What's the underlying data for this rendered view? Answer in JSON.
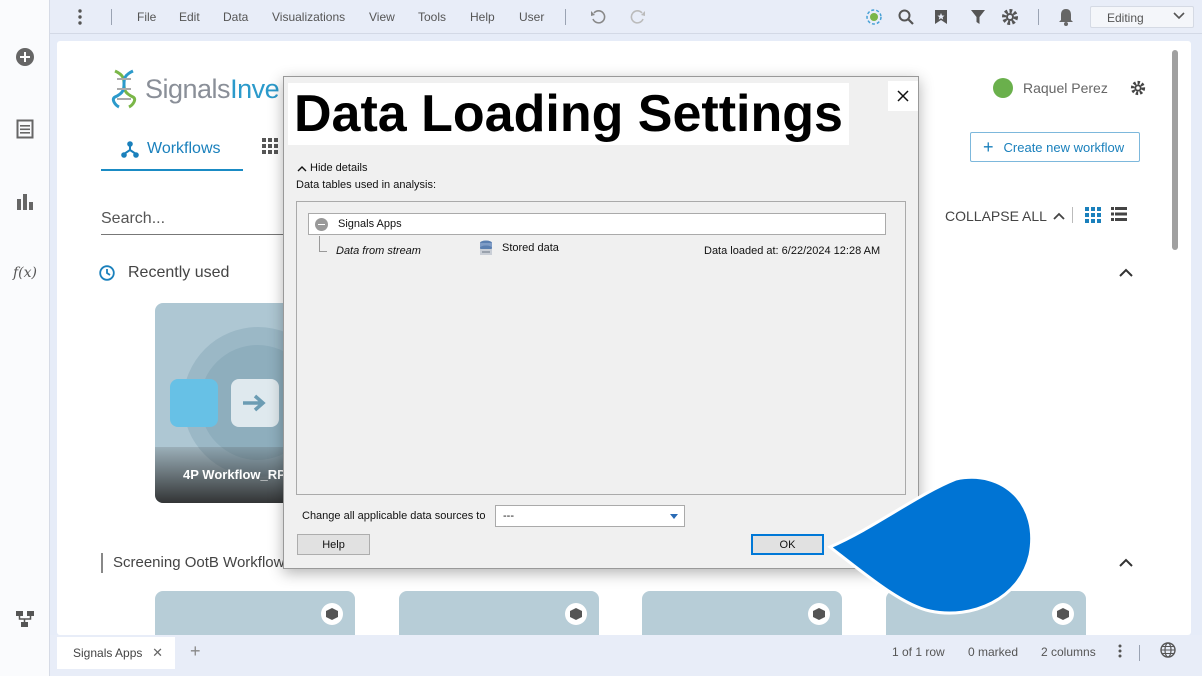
{
  "menubar": {
    "items": [
      "File",
      "Edit",
      "Data",
      "Visualizations",
      "View",
      "Tools",
      "Help",
      "User"
    ],
    "mode": "Editing"
  },
  "sidebar": {
    "icons": [
      "add-icon",
      "files-icon",
      "visualization-icon",
      "function-icon",
      "data-canvas-icon"
    ],
    "fx_label": "f(x)"
  },
  "app": {
    "logo_text_gray": "Signals",
    "logo_text_blue": "Inve",
    "user_name": "Raquel Perez",
    "tab_workflows": "Workflows",
    "create_button": "Create new workflow",
    "search_placeholder": "Search...",
    "collapse_all": "COLLAPSE ALL",
    "recently_used": "Recently used",
    "recent_card_label": "4P Workflow_RP",
    "section_screening": "Screening OotB Workflows"
  },
  "dialog": {
    "title": "Data Loading Settings",
    "hide_details": "Hide details",
    "tables_label": "Data tables used in analysis:",
    "group_name": "Signals Apps",
    "source_name": "Data from stream",
    "source_type": "Stored data",
    "loaded_at": "Data loaded at: 6/22/2024 12:28 AM",
    "change_label": "Change all applicable data sources to",
    "change_value": "---",
    "help_button": "Help",
    "ok_button": "OK"
  },
  "statusbar": {
    "tab_label": "Signals Apps",
    "rows": "1 of 1 row",
    "marked": "0 marked",
    "columns": "2 columns"
  },
  "colors": {
    "accent": "#1a80bc",
    "pin": "#0074d4",
    "menubar_bg": "#e8edf8"
  }
}
